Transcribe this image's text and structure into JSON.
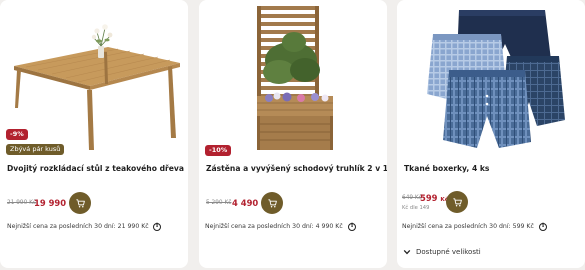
{
  "products": [
    {
      "image": "teak-extendable-table",
      "discount_badge": "-9%",
      "stock_badge": "Zbývá pár kusů",
      "title": "Dvojitý rozkládací stůl z teakového dřeva",
      "old_price": "21 990 Kč",
      "price": "19 990",
      "currency": "Kč",
      "lowest_price_note": "Nejnižší cena za posledních 30 dní: 21 990 Kč"
    },
    {
      "image": "trellis-planter",
      "discount_badge": "-10%",
      "title": "Zástěna a vyvýšený schodový truhlík 2 v 1",
      "old_price": "5 290 Kč",
      "price": "4 490",
      "currency": "Kč",
      "lowest_price_note": "Nejnižší cena za posledních 30 dní: 4 990 Kč"
    },
    {
      "image": "woven-boxer-shorts",
      "title": "Tkané boxerky, 4 ks",
      "old_price": "649 Kč",
      "price": "599",
      "currency": "Kč",
      "club_price": "Kč dle 149",
      "lowest_price_note": "Nejnižší cena za posledních 30 dní: 599 Kč",
      "sizes_label": "Dostupné velikosti"
    }
  ],
  "colors": {
    "sale": "#b2212f",
    "brand": "#6f5c2a",
    "background": "#f1efed"
  },
  "icons": {
    "cart": "cart-icon",
    "info": "info-icon",
    "chevron": "chevron-down-icon"
  }
}
